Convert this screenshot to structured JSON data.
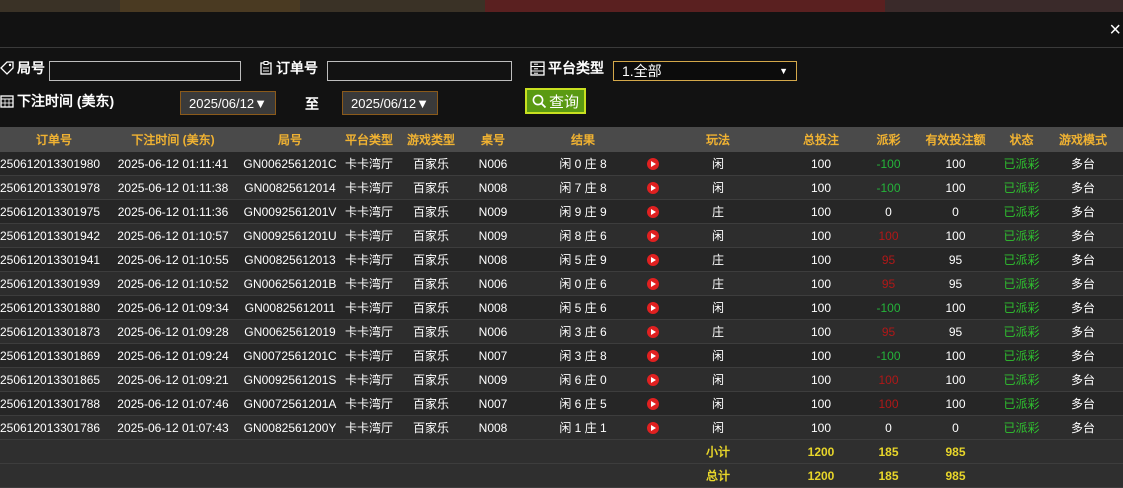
{
  "close_label": "×",
  "filters": {
    "round_label": "局号",
    "round_value": "",
    "order_label": "订单号",
    "order_value": "",
    "platform_label": "平台类型",
    "platform_selected": "1.全部",
    "time_label": "下注时间 (美东)",
    "date_from": "2025/06/12▼",
    "to_label": "至",
    "date_to": "2025/06/12▼",
    "query_label": "查询"
  },
  "table": {
    "headers": [
      "订单号",
      "下注时间 (美东)",
      "局号",
      "平台类型",
      "游戏类型",
      "桌号",
      "结果",
      "",
      "玩法",
      "总投注",
      "派彩",
      "有效投注额",
      "状态",
      "游戏模式"
    ],
    "rows": [
      {
        "order": "250612013301980",
        "time": "2025-06-12 01:11:41",
        "round": "GN0062561201C",
        "platform": "卡卡湾厅",
        "game": "百家乐",
        "table": "N006",
        "result": "闲 0 庄 8",
        "play": "闲",
        "bet": "100",
        "payout": "-100",
        "payout_class": "pos",
        "valid": "100",
        "status": "已派彩",
        "mode": "多台"
      },
      {
        "order": "250612013301978",
        "time": "2025-06-12 01:11:38",
        "round": "GN00825612014",
        "platform": "卡卡湾厅",
        "game": "百家乐",
        "table": "N008",
        "result": "闲 7 庄 8",
        "play": "闲",
        "bet": "100",
        "payout": "-100",
        "payout_class": "pos",
        "valid": "100",
        "status": "已派彩",
        "mode": "多台"
      },
      {
        "order": "250612013301975",
        "time": "2025-06-12 01:11:36",
        "round": "GN0092561201V",
        "platform": "卡卡湾厅",
        "game": "百家乐",
        "table": "N009",
        "result": "闲 9 庄 9",
        "play": "庄",
        "bet": "100",
        "payout": "0",
        "payout_class": "",
        "valid": "0",
        "status": "已派彩",
        "mode": "多台"
      },
      {
        "order": "250612013301942",
        "time": "2025-06-12 01:10:57",
        "round": "GN0092561201U",
        "platform": "卡卡湾厅",
        "game": "百家乐",
        "table": "N009",
        "result": "闲 8 庄 6",
        "play": "闲",
        "bet": "100",
        "payout": "100",
        "payout_class": "neg",
        "valid": "100",
        "status": "已派彩",
        "mode": "多台"
      },
      {
        "order": "250612013301941",
        "time": "2025-06-12 01:10:55",
        "round": "GN00825612013",
        "platform": "卡卡湾厅",
        "game": "百家乐",
        "table": "N008",
        "result": "闲 5 庄 9",
        "play": "庄",
        "bet": "100",
        "payout": "95",
        "payout_class": "neg",
        "valid": "95",
        "status": "已派彩",
        "mode": "多台"
      },
      {
        "order": "250612013301939",
        "time": "2025-06-12 01:10:52",
        "round": "GN0062561201B",
        "platform": "卡卡湾厅",
        "game": "百家乐",
        "table": "N006",
        "result": "闲 0 庄 6",
        "play": "庄",
        "bet": "100",
        "payout": "95",
        "payout_class": "neg",
        "valid": "95",
        "status": "已派彩",
        "mode": "多台"
      },
      {
        "order": "250612013301880",
        "time": "2025-06-12 01:09:34",
        "round": "GN00825612011",
        "platform": "卡卡湾厅",
        "game": "百家乐",
        "table": "N008",
        "result": "闲 5 庄 6",
        "play": "闲",
        "bet": "100",
        "payout": "-100",
        "payout_class": "pos",
        "valid": "100",
        "status": "已派彩",
        "mode": "多台"
      },
      {
        "order": "250612013301873",
        "time": "2025-06-12 01:09:28",
        "round": "GN00625612019",
        "platform": "卡卡湾厅",
        "game": "百家乐",
        "table": "N006",
        "result": "闲 3 庄 6",
        "play": "庄",
        "bet": "100",
        "payout": "95",
        "payout_class": "neg",
        "valid": "95",
        "status": "已派彩",
        "mode": "多台"
      },
      {
        "order": "250612013301869",
        "time": "2025-06-12 01:09:24",
        "round": "GN0072561201C",
        "platform": "卡卡湾厅",
        "game": "百家乐",
        "table": "N007",
        "result": "闲 3 庄 8",
        "play": "闲",
        "bet": "100",
        "payout": "-100",
        "payout_class": "pos",
        "valid": "100",
        "status": "已派彩",
        "mode": "多台"
      },
      {
        "order": "250612013301865",
        "time": "2025-06-12 01:09:21",
        "round": "GN0092561201S",
        "platform": "卡卡湾厅",
        "game": "百家乐",
        "table": "N009",
        "result": "闲 6 庄 0",
        "play": "闲",
        "bet": "100",
        "payout": "100",
        "payout_class": "neg",
        "valid": "100",
        "status": "已派彩",
        "mode": "多台"
      },
      {
        "order": "250612013301788",
        "time": "2025-06-12 01:07:46",
        "round": "GN0072561201A",
        "platform": "卡卡湾厅",
        "game": "百家乐",
        "table": "N007",
        "result": "闲 6 庄 5",
        "play": "闲",
        "bet": "100",
        "payout": "100",
        "payout_class": "neg",
        "valid": "100",
        "status": "已派彩",
        "mode": "多台"
      },
      {
        "order": "250612013301786",
        "time": "2025-06-12 01:07:43",
        "round": "GN0082561200Y",
        "platform": "卡卡湾厅",
        "game": "百家乐",
        "table": "N008",
        "result": "闲 1 庄 1",
        "play": "闲",
        "bet": "100",
        "payout": "0",
        "payout_class": "",
        "valid": "0",
        "status": "已派彩",
        "mode": "多台"
      }
    ],
    "subtotal": {
      "label": "小计",
      "bet": "1200",
      "payout": "185",
      "valid": "985"
    },
    "total": {
      "label": "总计",
      "bet": "1200",
      "payout": "185",
      "valid": "985"
    }
  },
  "colors": {
    "header_text": "#f0b232",
    "status_paid": "#2fc02f",
    "positive": "#24b43a",
    "negative": "#b01818",
    "totals": "#e8d62a"
  }
}
